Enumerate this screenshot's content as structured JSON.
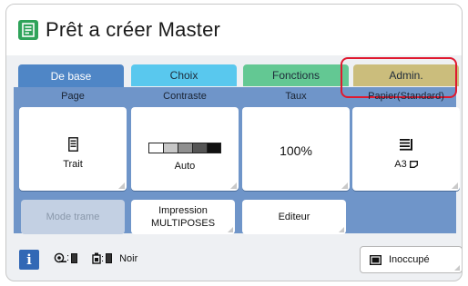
{
  "header": {
    "title": "Prêt a créer Master",
    "icon": "master-document-icon"
  },
  "tabs": [
    {
      "label": "De base",
      "color": "#4f86c6"
    },
    {
      "label": "Choix",
      "color": "#59c8ee"
    },
    {
      "label": "Fonctions",
      "color": "#63c893"
    },
    {
      "label": "Admin.",
      "color": "#cbbd7c"
    }
  ],
  "columns": {
    "page": {
      "label": "Page",
      "value": "Trait",
      "icon": "text-document-icon"
    },
    "contraste": {
      "label": "Contraste",
      "value": "Auto",
      "icon": "contrast-scale-icon"
    },
    "taux": {
      "label": "Taux",
      "value": "100%"
    },
    "papier": {
      "label": "Papier(Standard)",
      "value": "A3",
      "icon": "paper-feed-icon"
    }
  },
  "actions": {
    "mode_trame": "Mode trame",
    "impression_line1": "Impression",
    "impression_line2": "MULTIPOSES",
    "editeur": "Editeur"
  },
  "status": {
    "ink_label": "Noir",
    "state_button": "Inoccupé",
    "highlight_color": "#e0192f"
  }
}
